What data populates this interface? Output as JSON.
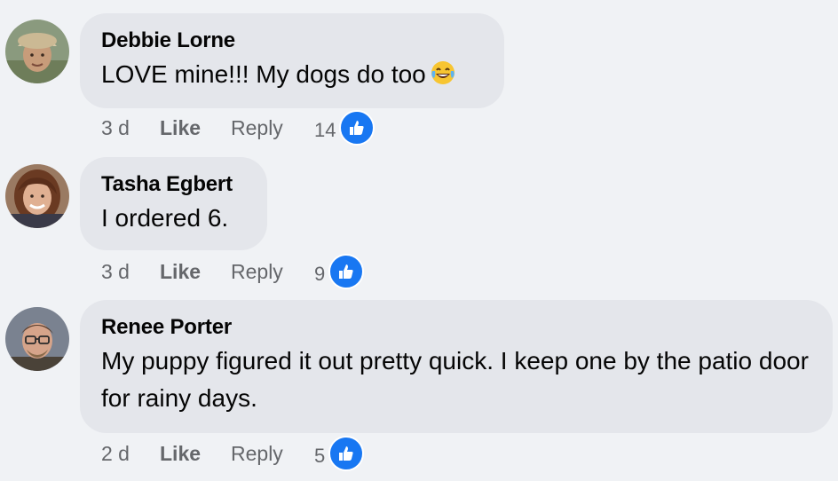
{
  "comments": [
    {
      "author": "Debbie Lorne",
      "text": "LOVE mine!!! My dogs do too",
      "emoji": "laughing-crying-emoji",
      "time": "3 d",
      "like_label": "Like",
      "reply_label": "Reply",
      "reaction_count": "14",
      "reaction_icon": "thumbs-up-icon"
    },
    {
      "author": "Tasha Egbert",
      "text": "I ordered 6.",
      "time": "3 d",
      "like_label": "Like",
      "reply_label": "Reply",
      "reaction_count": "9",
      "reaction_icon": "thumbs-up-icon"
    },
    {
      "author": "Renee Porter",
      "text": "My puppy figured it out pretty quick. I keep one by the patio door for rainy days.",
      "time": "2 d",
      "like_label": "Like",
      "reply_label": "Reply",
      "reaction_count": "5",
      "reaction_icon": "thumbs-up-icon"
    }
  ],
  "colors": {
    "background": "#f0f2f5",
    "bubble": "#e4e6eb",
    "meta_text": "#65676b",
    "like_blue": "#1877f2"
  }
}
